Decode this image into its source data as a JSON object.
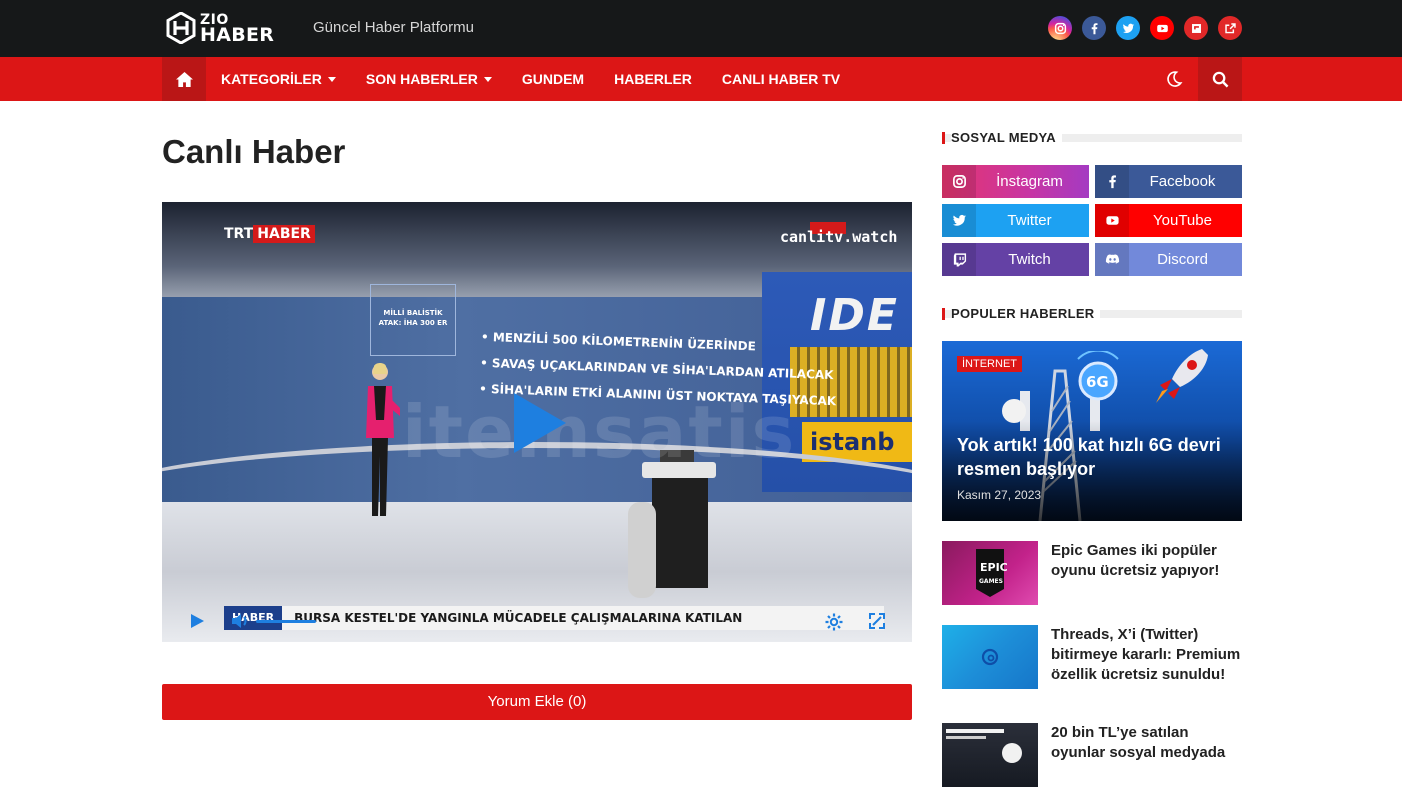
{
  "header": {
    "logo_line1": "ZIO",
    "logo_line2": "HABER",
    "tagline": "Güncel Haber Platformu",
    "socials": [
      {
        "name": "instagram",
        "color": "#c13584"
      },
      {
        "name": "facebook",
        "color": "#3b5998"
      },
      {
        "name": "twitter",
        "color": "#1da1f2"
      },
      {
        "name": "youtube",
        "color": "#ff0000"
      },
      {
        "name": "flipboard",
        "color": "#e12828"
      },
      {
        "name": "external-link",
        "color": "#e12828"
      }
    ]
  },
  "nav": {
    "home_icon": "home-icon",
    "items": [
      {
        "label": "KATEGORİLER",
        "dropdown": true
      },
      {
        "label": "SON HABERLER",
        "dropdown": true
      },
      {
        "label": "GUNDEM",
        "dropdown": false
      },
      {
        "label": "HABERLER",
        "dropdown": false
      },
      {
        "label": "CANLI HABER TV",
        "dropdown": false
      }
    ],
    "theme_icon": "moon-icon",
    "search_icon": "search-icon",
    "accent": "#dc1616"
  },
  "main": {
    "title": "Canlı Haber",
    "video": {
      "channel_a": "TRT",
      "channel_b": "HABER",
      "watermark_site": "canlitv.watch",
      "ticker_label": "HABER",
      "ticker_text": "BURSA KESTEL'DE YANGINLA MÜCADELE ÇALIŞMALARINA KATILAN",
      "graphic_box": "MİLLİ BALİSTİK ATAK: İHA 300 ER",
      "bullets": [
        "• MENZİLİ 500 KİLOMETRENİN ÜZERİNDE",
        "• SAVAŞ UÇAKLARINDAN VE SİHA'LARDAN ATILACAK",
        "• SİHA'LARIN ETKİ ALANINI ÜST NOKTAYA TAŞIYACAK"
      ],
      "backdrop_text": "IDE",
      "backdrop_city": "istanb"
    },
    "comment_button": "Yorum Ekle (0)"
  },
  "sidebar": {
    "social_title": "SOSYAL MEDYA",
    "social_buttons": [
      {
        "label": "İnstagram",
        "icon": "instagram-icon",
        "color": "#d6246e"
      },
      {
        "label": "Facebook",
        "icon": "facebook-icon",
        "color": "#3b5998"
      },
      {
        "label": "Twitter",
        "icon": "twitter-icon",
        "color": "#1da1f2"
      },
      {
        "label": "YouTube",
        "icon": "youtube-icon",
        "color": "#ff0000"
      },
      {
        "label": "Twitch",
        "icon": "twitch-icon",
        "color": "#6441a5"
      },
      {
        "label": "Discord",
        "icon": "discord-icon",
        "color": "#7289da"
      }
    ],
    "popular_title": "POPULER HABERLER",
    "featured": {
      "category": "İNTERNET",
      "title": "Yok artık! 100 kat hızlı 6G devri resmen başlıyor",
      "date": "Kasım 27, 2023"
    },
    "posts": [
      {
        "title": "Epic Games iki popüler oyunu ücretsiz yapıyor!"
      },
      {
        "title": "Threads, X’i (Twitter) bitirmeye kararlı: Premium özellik ücretsiz sunuldu!"
      },
      {
        "title": "20 bin TL’ye satılan oyunlar sosyal medyada"
      }
    ]
  }
}
